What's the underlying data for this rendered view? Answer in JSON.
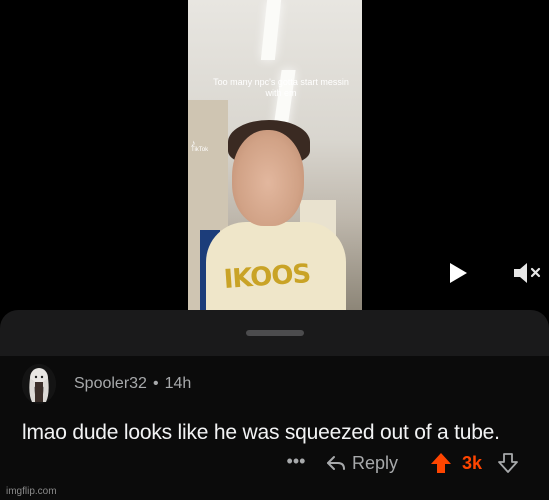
{
  "video": {
    "caption": "Too many npc's gotta start messin with em",
    "platform_mark": "TikTok",
    "shirt_print": "IKOOS",
    "icons": [
      "tiktok-logo-icon",
      "play-icon",
      "mute-icon"
    ]
  },
  "comment": {
    "author": "Spooler32",
    "separator": "•",
    "age": "14h",
    "body": "lmao dude looks like he was squeezed out of a tube.",
    "more_label": "•••",
    "reply_label": "Reply",
    "score": "3k",
    "upvoted": true,
    "icons": [
      "more-icon",
      "reply-arrow-icon",
      "upvote-icon",
      "downvote-icon"
    ]
  },
  "colors": {
    "background": "#000000",
    "sheet": "#1a1a1b",
    "text_primary": "#f2f3f4",
    "text_secondary": "#a7a9ab",
    "upvote_accent": "#ff4500"
  },
  "watermark": "imgflip.com"
}
